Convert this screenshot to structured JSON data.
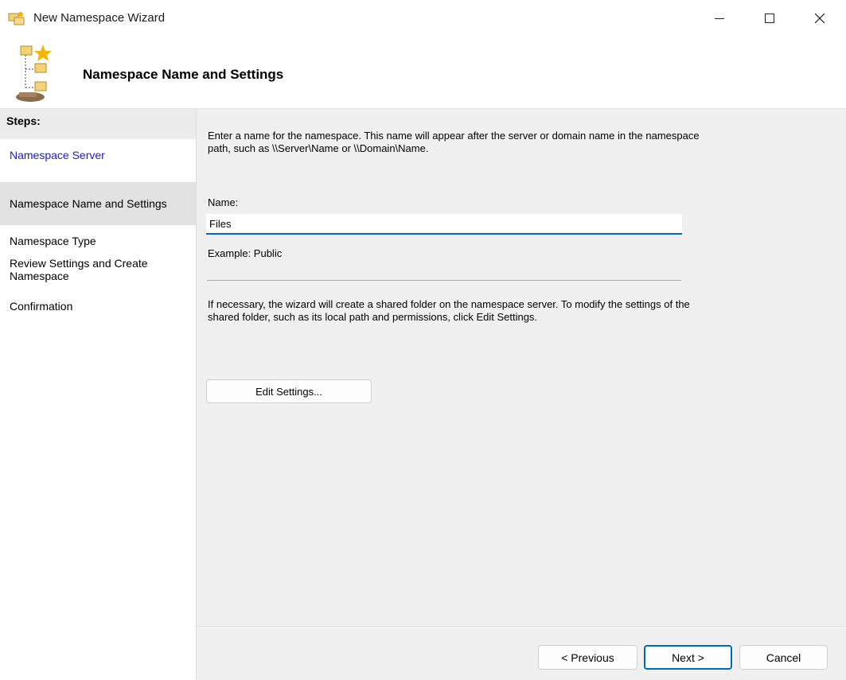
{
  "window": {
    "title": "New Namespace Wizard"
  },
  "header": {
    "title": "Namespace Name and Settings"
  },
  "steps": {
    "heading": "Steps:",
    "items": [
      "Namespace Server",
      "Namespace Name and Settings",
      "Namespace Type",
      "Review Settings and Create Namespace",
      "Confirmation"
    ]
  },
  "content": {
    "intro": "Enter a name for the namespace. This name will appear after the server or domain name in the namespace path, such as \\\\Server\\Name or \\\\Domain\\Name.",
    "name_label": "Name:",
    "name_value": "Files",
    "example": "Example: Public",
    "info": "If necessary, the wizard will create a shared folder on the namespace server. To modify the settings of the shared folder, such as its local path and permissions, click Edit Settings.",
    "edit_button": "Edit Settings..."
  },
  "footer": {
    "previous": "< Previous",
    "next": "Next >",
    "cancel": "Cancel"
  },
  "colors": {
    "accent": "#0067c0",
    "link": "#1a1ad6",
    "panel": "#f0f0f0"
  }
}
